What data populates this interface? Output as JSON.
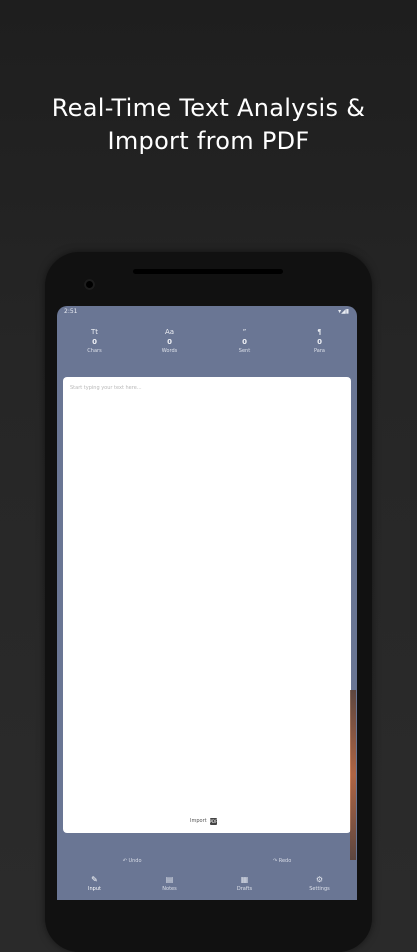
{
  "promo": {
    "headline": "Real-Time Text Analysis &\nImport from PDF"
  },
  "status_bar": {
    "time": "2:51",
    "right_icons": "▾◢▮"
  },
  "stats": [
    {
      "icon": "Tt",
      "value": "0",
      "label": "Chars"
    },
    {
      "icon": "Aa",
      "value": "0",
      "label": "Words"
    },
    {
      "icon": "”",
      "value": "0",
      "label": "Sent"
    },
    {
      "icon": "¶",
      "value": "0",
      "label": "Para"
    }
  ],
  "editor": {
    "placeholder": "Start typing your text here...",
    "import_label": "Import",
    "import_icon": "PDF"
  },
  "undo_redo": {
    "undo_label": "↶ Undo",
    "redo_label": "↷ Redo"
  },
  "tabs": [
    {
      "icon": "✎",
      "label": "Input"
    },
    {
      "icon": "▤",
      "label": "Notes"
    },
    {
      "icon": "▦",
      "label": "Drafts"
    },
    {
      "icon": "⚙",
      "label": "Settings"
    }
  ]
}
